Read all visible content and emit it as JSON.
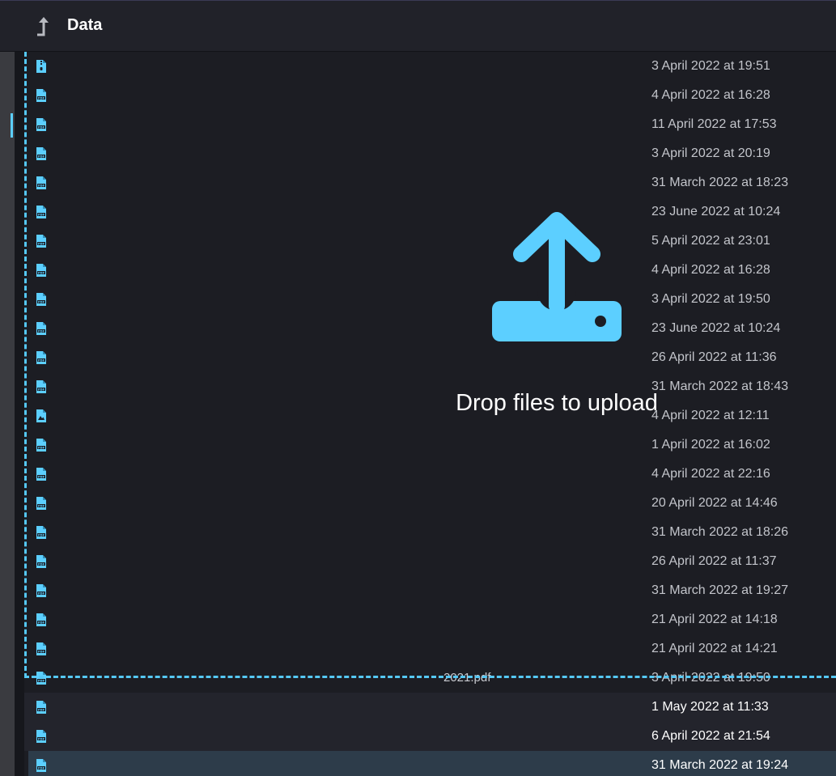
{
  "header": {
    "title": "Data"
  },
  "dropzone": {
    "message": "Drop files to upload"
  },
  "colors": {
    "accent": "#5ccfff",
    "background": "#1c1d23",
    "selected_row": "#2d3c4a"
  },
  "files": [
    {
      "icon": "archive-file-icon",
      "name": "",
      "modified": "3 April 2022 at 19:51"
    },
    {
      "icon": "pdf-file-icon",
      "name": "",
      "modified": "4 April 2022 at 16:28"
    },
    {
      "icon": "pdf-file-icon",
      "name": "",
      "modified": "11 April 2022 at 17:53"
    },
    {
      "icon": "pdf-file-icon",
      "name": "",
      "modified": "3 April 2022 at 20:19"
    },
    {
      "icon": "pdf-file-icon",
      "name": "",
      "modified": "31 March 2022 at 18:23"
    },
    {
      "icon": "pdf-file-icon",
      "name": "",
      "modified": "23 June 2022 at 10:24"
    },
    {
      "icon": "pdf-file-icon",
      "name": "",
      "modified": "5 April 2022 at 23:01"
    },
    {
      "icon": "pdf-file-icon",
      "name": "",
      "modified": "4 April 2022 at 16:28"
    },
    {
      "icon": "pdf-file-icon",
      "name": "",
      "modified": "3 April 2022 at 19:50"
    },
    {
      "icon": "pdf-file-icon",
      "name": "",
      "modified": "23 June 2022 at 10:24"
    },
    {
      "icon": "pdf-file-icon",
      "name": "",
      "modified": "26 April 2022 at 11:36"
    },
    {
      "icon": "pdf-file-icon",
      "name": "",
      "modified": "31 March 2022 at 18:43"
    },
    {
      "icon": "image-file-icon",
      "name": "",
      "modified": "4 April 2022 at 12:11"
    },
    {
      "icon": "pdf-file-icon",
      "name": "",
      "modified": "1 April 2022 at 16:02"
    },
    {
      "icon": "pdf-file-icon",
      "name": "",
      "modified": "4 April 2022 at 22:16"
    },
    {
      "icon": "pdf-file-icon",
      "name": "",
      "modified": "20 April 2022 at 14:46"
    },
    {
      "icon": "pdf-file-icon",
      "name": "",
      "modified": "31 March 2022 at 18:26"
    },
    {
      "icon": "pdf-file-icon",
      "name": "",
      "modified": "26 April 2022 at 11:37"
    },
    {
      "icon": "pdf-file-icon",
      "name": "",
      "modified": "31 March 2022 at 19:27"
    },
    {
      "icon": "pdf-file-icon",
      "name": "",
      "modified": "21 April 2022 at 14:18"
    },
    {
      "icon": "pdf-file-icon",
      "name": "",
      "modified": "21 April 2022 at 14:21"
    },
    {
      "icon": "pdf-file-icon",
      "name": "2021.pdf",
      "modified": "3 April 2022 at 19:50"
    },
    {
      "icon": "pdf-file-icon",
      "name": "",
      "modified": "1 May 2022 at 11:33"
    },
    {
      "icon": "pdf-file-icon",
      "name": "",
      "modified": "6 April 2022 at 21:54"
    },
    {
      "icon": "pdf-file-icon",
      "name": "",
      "modified": "31 March 2022 at 19:24",
      "selected": true
    }
  ]
}
